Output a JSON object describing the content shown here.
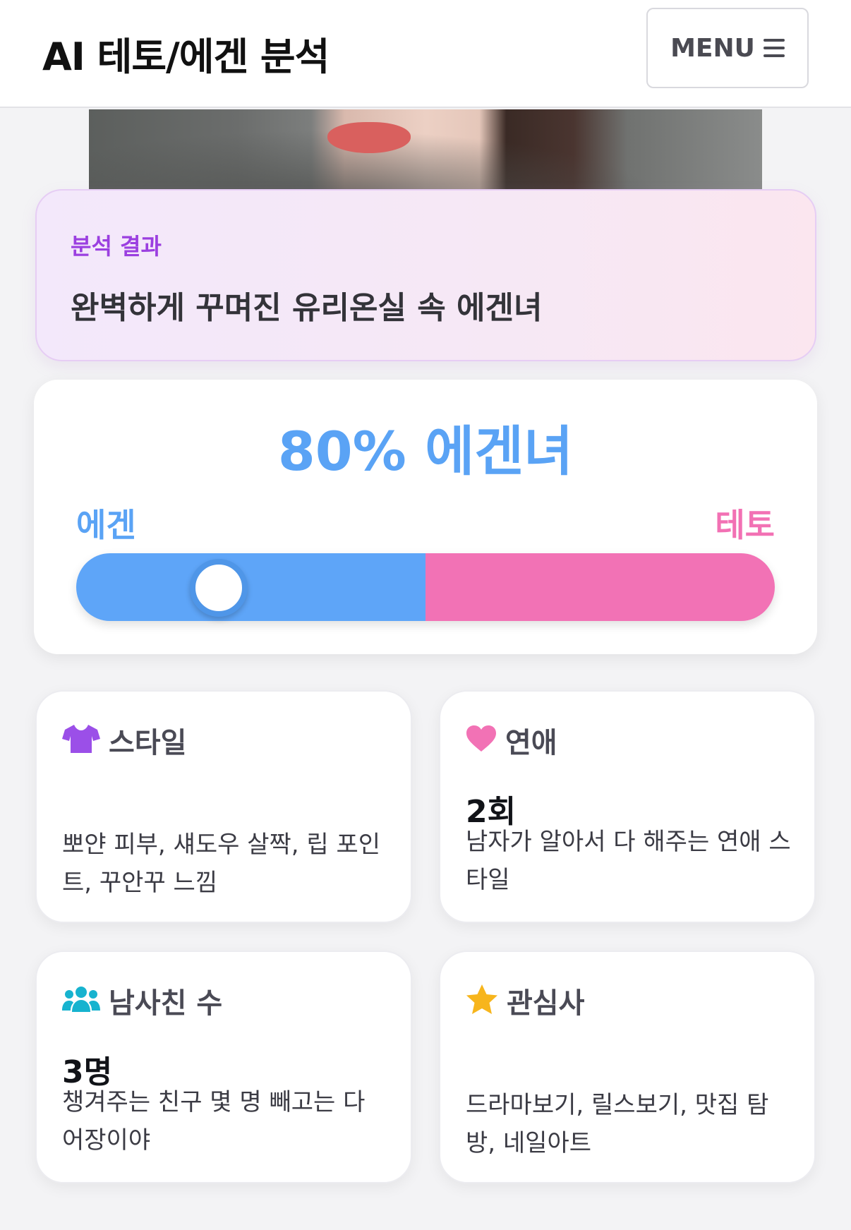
{
  "header": {
    "title": "AI 테토/에겐 분석",
    "menu_label": "MENU"
  },
  "result": {
    "label": "분석 결과",
    "text": "완벽하게 꾸며진 유리온실 속 에겐녀"
  },
  "score": {
    "title": "80% 에겐녀",
    "left_label": "에겐",
    "right_label": "테토",
    "egen_percent": 80,
    "colors": {
      "egen": "#5ea5f8",
      "teto": "#f272b5"
    }
  },
  "cards": {
    "style": {
      "icon": "tshirt-icon",
      "title": "스타일",
      "value": "",
      "desc": "뽀얀 피부, 섀도우 살짝, 립 포인트, 꾸안꾸 느낌"
    },
    "dating": {
      "icon": "heart-icon",
      "title": "연애",
      "value": "2회",
      "desc": "남자가 알아서 다 해주는 연애 스타일"
    },
    "friends": {
      "icon": "users-icon",
      "title": "남사친 수",
      "value": "3명",
      "desc": "챙겨주는 친구 몇 명 빼고는 다 어장이야"
    },
    "interests": {
      "icon": "star-icon",
      "title": "관심사",
      "value": "",
      "desc": "드라마보기, 릴스보기, 맛집 탐방, 네일아트"
    }
  }
}
